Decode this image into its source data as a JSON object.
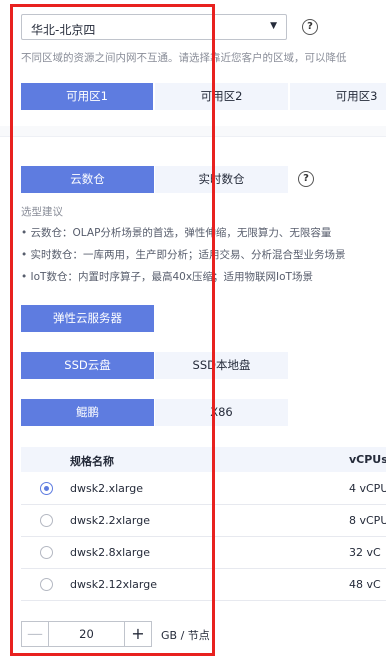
{
  "region": {
    "selected": "华北-北京四",
    "help": "?",
    "description": "不同区域的资源之间内网不互通。请选择靠近您客户的区域，可以降低"
  },
  "availability_zones": [
    "可用区1",
    "可用区2",
    "可用区3"
  ],
  "warehouse_type": {
    "options": [
      "云数仓",
      "实时数仓"
    ],
    "help": "?",
    "hint_title": "选型建议",
    "hints": [
      "• 云数仓：OLAP分析场景的首选，弹性伸缩，无限算力、无限容量",
      "• 实时数仓：一库两用，生产即分析；适用交易、分析混合型业务场景",
      "• IoT数仓：内置时序算子，最高40x压缩；适用物联网IoT场景"
    ]
  },
  "compute_type": {
    "option": "弹性云服务器"
  },
  "storage_type": {
    "options": [
      "SSD云盘",
      "SSD本地盘"
    ]
  },
  "cpu_arch": {
    "options": [
      "鲲鹏",
      "X86"
    ]
  },
  "flavor_table": {
    "headers": [
      "规格名称",
      "vCPUs"
    ],
    "rows": [
      {
        "name": "dwsk2.xlarge",
        "vcpus": "4 vCPU",
        "selected": true
      },
      {
        "name": "dwsk2.2xlarge",
        "vcpus": "8 vCPU",
        "selected": false
      },
      {
        "name": "dwsk2.8xlarge",
        "vcpus": "32 vC",
        "selected": false
      },
      {
        "name": "dwsk2.12xlarge",
        "vcpus": "48 vC",
        "selected": false
      }
    ]
  },
  "storage_capacity": {
    "value": "20",
    "unit": "GB / 节点",
    "minus": "—",
    "plus": "+"
  },
  "colors": {
    "accent": "#5e7ce0",
    "highlight_border": "#e8211f"
  }
}
